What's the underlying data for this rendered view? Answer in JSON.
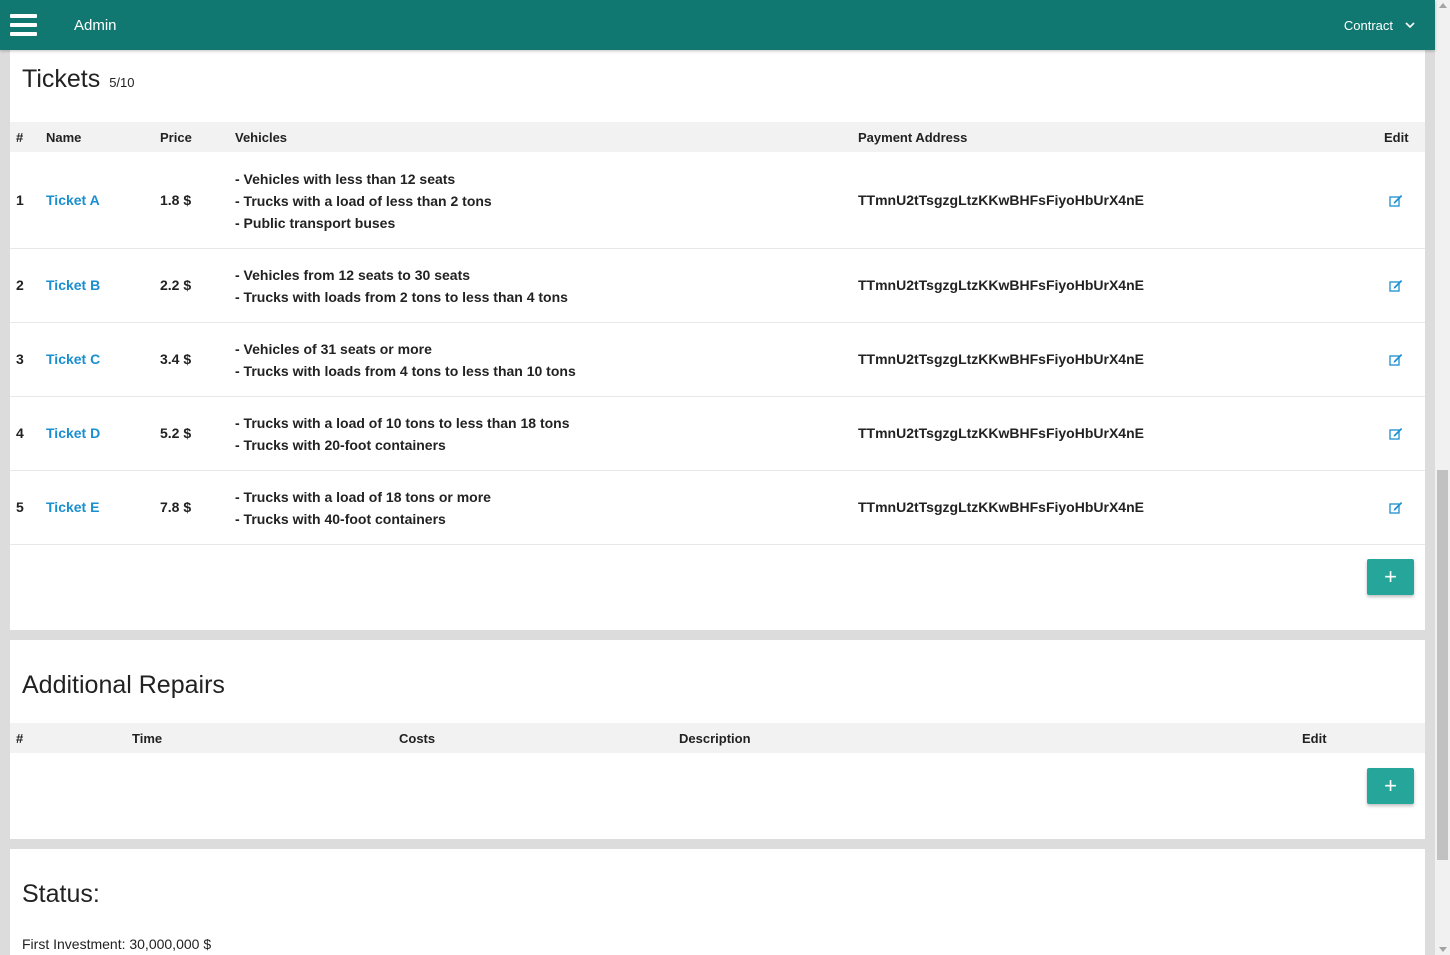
{
  "header": {
    "brand": "Admin",
    "contract_label": "Contract"
  },
  "tickets": {
    "title": "Tickets",
    "count": "5/10",
    "columns": {
      "num": "#",
      "name": "Name",
      "price": "Price",
      "vehicles": "Vehicles",
      "address": "Payment Address",
      "edit": "Edit"
    },
    "rows": [
      {
        "num": "1",
        "name": "Ticket A",
        "price": "1.8 $",
        "vehicles": [
          "- Vehicles with less than 12 seats",
          "- Trucks with a load of less than 2 tons",
          "- Public transport buses"
        ],
        "address": "TTmnU2tTsgzgLtzKKwBHFsFiyoHbUrX4nE"
      },
      {
        "num": "2",
        "name": "Ticket B",
        "price": "2.2 $",
        "vehicles": [
          "- Vehicles from 12 seats to 30 seats",
          "- Trucks with loads from 2 tons to less than 4 tons"
        ],
        "address": "TTmnU2tTsgzgLtzKKwBHFsFiyoHbUrX4nE"
      },
      {
        "num": "3",
        "name": "Ticket C",
        "price": "3.4 $",
        "vehicles": [
          "- Vehicles of 31 seats or more",
          "- Trucks with loads from 4 tons to less than 10 tons"
        ],
        "address": "TTmnU2tTsgzgLtzKKwBHFsFiyoHbUrX4nE"
      },
      {
        "num": "4",
        "name": "Ticket D",
        "price": "5.2 $",
        "vehicles": [
          "- Trucks with a load of 10 tons to less than 18 tons",
          "- Trucks with 20-foot containers"
        ],
        "address": "TTmnU2tTsgzgLtzKKwBHFsFiyoHbUrX4nE"
      },
      {
        "num": "5",
        "name": "Ticket E",
        "price": "7.8 $",
        "vehicles": [
          "- Trucks with a load of 18 tons or more",
          "- Trucks with 40-foot containers"
        ],
        "address": "TTmnU2tTsgzgLtzKKwBHFsFiyoHbUrX4nE"
      }
    ],
    "add_label": "+"
  },
  "repairs": {
    "title": "Additional Repairs",
    "columns": {
      "num": "#",
      "time": "Time",
      "costs": "Costs",
      "description": "Description",
      "edit": "Edit"
    },
    "add_label": "+"
  },
  "status": {
    "title": "Status:",
    "first_investment": "First Investment: 30,000,000 $"
  },
  "colors": {
    "header": "#107870",
    "accent": "#26a69a",
    "link": "#1a8fd0"
  },
  "icons": {
    "menu": "menu-icon",
    "chevron": "chevron-down-icon",
    "edit": "edit-icon"
  }
}
